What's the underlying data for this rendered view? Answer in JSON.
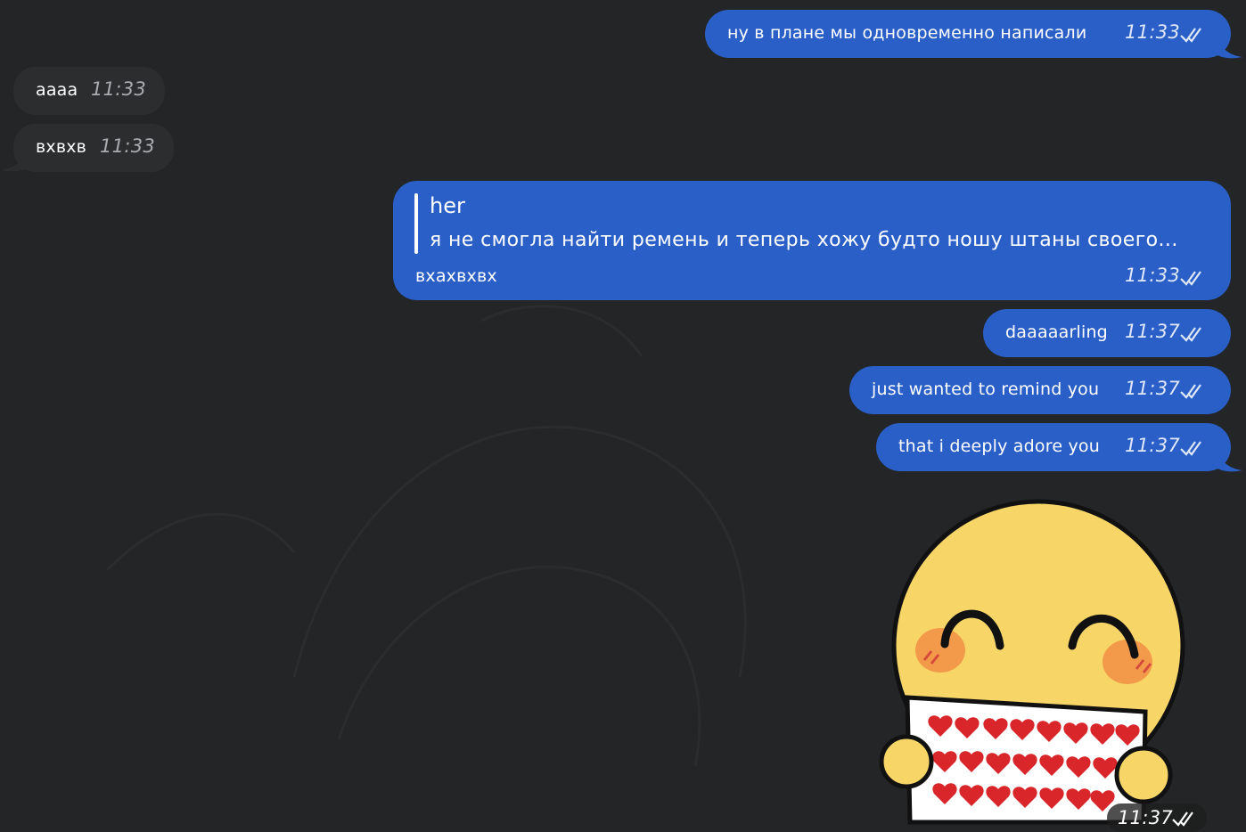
{
  "chat": {
    "messages": [
      {
        "id": "m1",
        "direction": "outgoing",
        "text": "ну в плане мы одновременно написали",
        "time": "11:33",
        "status": "read"
      },
      {
        "id": "m2",
        "direction": "incoming",
        "text": "аааа",
        "time": "11:33"
      },
      {
        "id": "m3",
        "direction": "incoming",
        "text": "вхвхв",
        "time": "11:33"
      },
      {
        "id": "m4",
        "direction": "outgoing",
        "reply": {
          "author": "her",
          "text": "я не смогла найти ремень и теперь хожу будто ношу штаны своего..."
        },
        "text": "вхахвхвх",
        "time": "11:33",
        "status": "read"
      },
      {
        "id": "m5",
        "direction": "outgoing",
        "text": "daaaaarling",
        "time": "11:37",
        "status": "read"
      },
      {
        "id": "m6",
        "direction": "outgoing",
        "text": "just wanted to remind you",
        "time": "11:37",
        "status": "read"
      },
      {
        "id": "m7",
        "direction": "outgoing",
        "text": "that i deeply adore you",
        "time": "11:37",
        "status": "read"
      },
      {
        "id": "m8",
        "direction": "outgoing",
        "type": "sticker",
        "sticker": "blushing-smiley-holding-hearts-sign",
        "time": "11:37",
        "status": "read"
      }
    ]
  },
  "colors": {
    "background": "#232527",
    "outgoing_bubble": "#2a5fc7",
    "incoming_bubble": "#2b2d2f",
    "sticker_face": "#f7d667"
  },
  "icons": {
    "read_status": "double-check-icon"
  }
}
